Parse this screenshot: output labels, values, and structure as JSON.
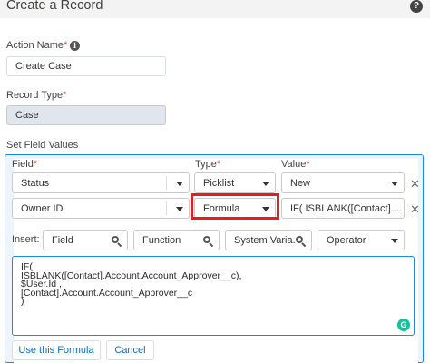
{
  "header": {
    "title": "Create a Record",
    "help_icon": "help-icon"
  },
  "action_name": {
    "label": "Action Name",
    "required_mark": "*",
    "value": "Create Case",
    "info_icon": "info-icon"
  },
  "record_type": {
    "label": "Record Type",
    "required_mark": "*",
    "value": "Case"
  },
  "field_values": {
    "label": "Set Field Values",
    "columns": {
      "field": "Field",
      "type": "Type",
      "value": "Value",
      "required_mark": "*"
    },
    "rows": [
      {
        "field": "Status",
        "type": "Picklist",
        "value": "New"
      },
      {
        "field": "Owner ID",
        "type": "Formula",
        "value": "IF( ISBLANK([Contact]...."
      }
    ]
  },
  "insert": {
    "label": "Insert:",
    "field_placeholder": "Field",
    "function_placeholder": "Function",
    "system_variables_placeholder": "System Varia...",
    "operator": "Operator"
  },
  "formula": {
    "text": "IF(\nISBLANK([Contact].Account.Account_Approver__c),\n$User.Id ,\n[Contact].Account.Account_Approver__c\n)"
  },
  "buttons": {
    "use_formula": "Use this Formula",
    "cancel": "Cancel"
  },
  "colors": {
    "accent": "#1589ee",
    "highlight": "#e02020",
    "link": "#0070d2"
  }
}
